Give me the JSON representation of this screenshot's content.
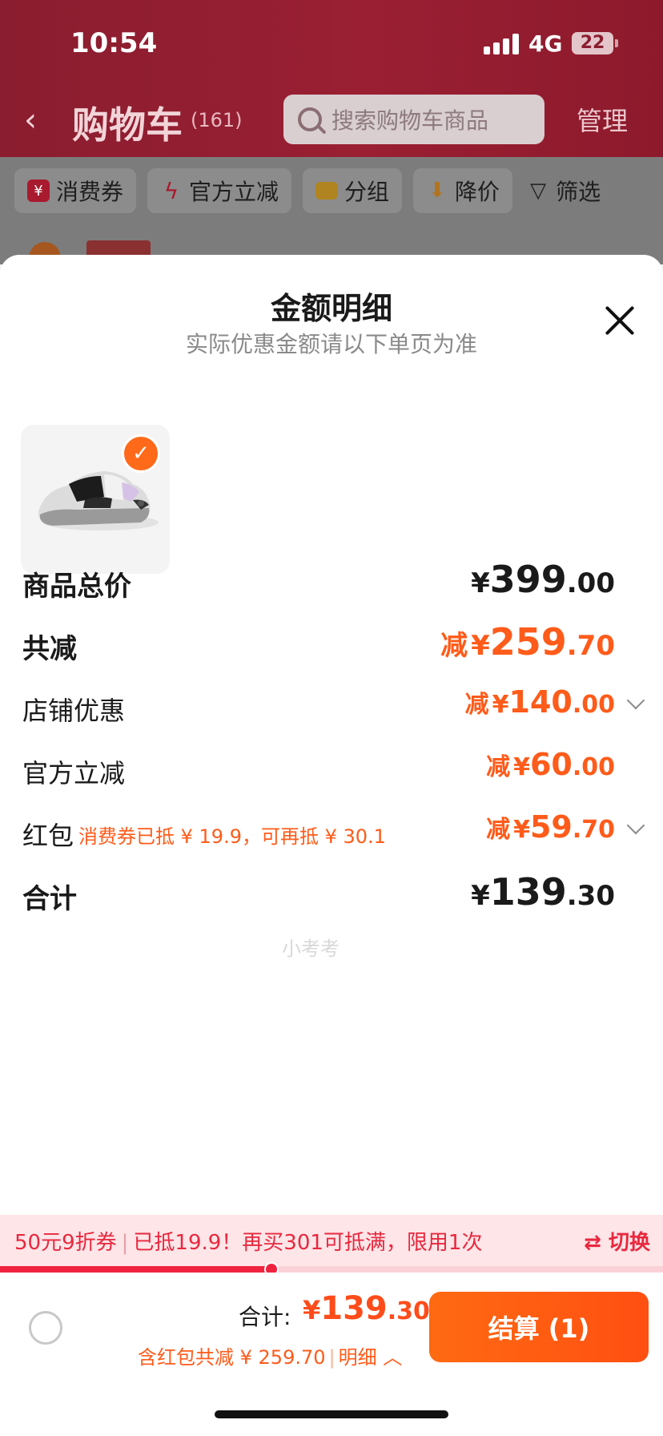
{
  "status": {
    "time": "10:54",
    "network": "4G",
    "battery": "22"
  },
  "nav": {
    "title": "购物车",
    "count": "(161)",
    "search_placeholder": "搜索购物车商品",
    "manage": "管理"
  },
  "filters": [
    {
      "label": "消费券",
      "icon": "coupon-icon",
      "color": "#d0203a"
    },
    {
      "label": "官方立减",
      "icon": "lightning-icon",
      "color": "#d0203a"
    },
    {
      "label": "分组",
      "icon": "folder-icon",
      "color": "#e0a020"
    },
    {
      "label": "降价",
      "icon": "price-drop-icon",
      "color": "#e09020"
    },
    {
      "label": "筛选",
      "icon": "filter-icon",
      "color": "#1e1e1e"
    }
  ],
  "sheet": {
    "title": "金额明细",
    "subtitle": "实际优惠金额请以下单页为准",
    "watermark": "小考考",
    "rows": {
      "goods_total": {
        "label": "商品总价",
        "cur": "¥",
        "int": "399",
        "dec": ".00"
      },
      "total_discount": {
        "label": "共减",
        "pre": "减",
        "cur": "¥",
        "int": "259",
        "dec": ".70"
      },
      "shop_discount": {
        "label": "店铺优惠",
        "pre": "减",
        "cur": "¥",
        "int": "140",
        "dec": ".00"
      },
      "official_discount": {
        "label": "官方立减",
        "pre": "减",
        "cur": "¥",
        "int": "60",
        "dec": ".00"
      },
      "red_packet": {
        "label": "红包",
        "note": "消费券已抵 ¥ 19.9，可再抵 ¥ 30.1",
        "pre": "减",
        "cur": "¥",
        "int": "59",
        "dec": ".70"
      },
      "sum": {
        "label": "合计",
        "cur": "¥",
        "int": "139",
        "dec": ".30"
      }
    }
  },
  "promo": {
    "coupon": "50元9折券",
    "message": "已抵19.9！再买301可抵满，限用1次",
    "switch": "⇄ 切换",
    "progress": 0.41
  },
  "bottom": {
    "total_label": "合计:",
    "cur": "¥",
    "int": "139",
    "dec": ".30",
    "sub_text": "含红包共减 ¥ 259.70",
    "detail": "明细",
    "checkout": "结算 (1)"
  }
}
